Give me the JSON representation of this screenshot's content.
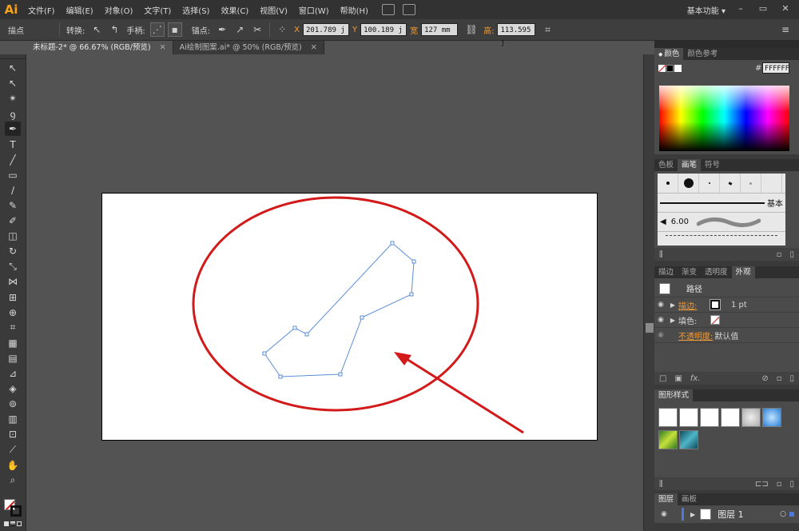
{
  "app": {
    "logo": "Ai",
    "menu": [
      "文件(F)",
      "编辑(E)",
      "对象(O)",
      "文字(T)",
      "选择(S)",
      "效果(C)",
      "视图(V)",
      "窗口(W)",
      "帮助(H)"
    ],
    "workspace": "基本功能",
    "workspace_arrow": "▾",
    "window_buttons": [
      "–",
      "▭",
      "✕"
    ]
  },
  "controlbar": {
    "mode_label": "描点",
    "convert_label": "转换:",
    "handles_label": "手柄:",
    "anchor_label": "锚点:",
    "x_label": "X",
    "x_value": "201.789 j",
    "y_label": "Y",
    "y_value": "100.189 j",
    "w_label": "宽",
    "w_value": "127 mm",
    "h_label": "高:",
    "h_value": "113.595 j"
  },
  "tabs": [
    {
      "label": "未标题-2* @ 66.67% (RGB/预览)",
      "close": "✕"
    },
    {
      "label": "Ai绘制图案.ai* @ 50% (RGB/预览)",
      "close": "✕"
    }
  ],
  "tools": [
    {
      "name": "selection-tool",
      "glyph": "↖"
    },
    {
      "name": "direct-selection-tool",
      "glyph": "↖"
    },
    {
      "name": "magic-wand-tool",
      "glyph": "✴"
    },
    {
      "name": "lasso-tool",
      "glyph": "ꝯ"
    },
    {
      "name": "pen-tool",
      "glyph": "✒"
    },
    {
      "name": "type-tool",
      "glyph": "T"
    },
    {
      "name": "line-tool",
      "glyph": "╱"
    },
    {
      "name": "rectangle-tool",
      "glyph": "▭"
    },
    {
      "name": "paintbrush-tool",
      "glyph": "∕"
    },
    {
      "name": "pencil-tool",
      "glyph": "✎"
    },
    {
      "name": "blob-brush-tool",
      "glyph": "✐"
    },
    {
      "name": "eraser-tool",
      "glyph": "◫"
    },
    {
      "name": "rotate-tool",
      "glyph": "↻"
    },
    {
      "name": "scale-tool",
      "glyph": "⤡"
    },
    {
      "name": "width-tool",
      "glyph": "⋈"
    },
    {
      "name": "free-transform-tool",
      "glyph": "⊞"
    },
    {
      "name": "shape-builder-tool",
      "glyph": "⊕"
    },
    {
      "name": "perspective-grid-tool",
      "glyph": "⌗"
    },
    {
      "name": "mesh-tool",
      "glyph": "▦"
    },
    {
      "name": "gradient-tool",
      "glyph": "▤"
    },
    {
      "name": "eyedropper-tool",
      "glyph": "⊿"
    },
    {
      "name": "blend-tool",
      "glyph": "◈"
    },
    {
      "name": "symbol-sprayer-tool",
      "glyph": "⊚"
    },
    {
      "name": "column-graph-tool",
      "glyph": "▥"
    },
    {
      "name": "artboard-tool",
      "glyph": "⊡"
    },
    {
      "name": "slice-tool",
      "glyph": "⟋"
    },
    {
      "name": "hand-tool",
      "glyph": "✋"
    },
    {
      "name": "zoom-tool",
      "glyph": "⌕"
    }
  ],
  "color_panel": {
    "tabs": [
      "颜色",
      "颜色参考"
    ],
    "hash": "#",
    "hex": "FFFFFF",
    "expand": "◆"
  },
  "brush_panel": {
    "tabs": [
      "色板",
      "画笔",
      "符号"
    ],
    "basic_label": "基本",
    "size_value": "6.00"
  },
  "appearance_panel": {
    "tabs": [
      "描边",
      "渐变",
      "透明度",
      "外观"
    ],
    "title": "路径",
    "rows": [
      {
        "label": "描边:",
        "value": "1 pt"
      },
      {
        "label": "填色:",
        "value": ""
      },
      {
        "label": "不透明度:",
        "value": "默认值"
      }
    ],
    "fx": "fx."
  },
  "graphic_styles_panel": {
    "tabs": [
      "图形样式"
    ]
  },
  "layers_panel": {
    "tabs": [
      "图层",
      "画板"
    ],
    "layer_name": "图层 1"
  },
  "colors": {
    "accent_orange": "#f39c34",
    "annotation_red": "#d21a1a",
    "path_blue": "#5b8fd6"
  }
}
